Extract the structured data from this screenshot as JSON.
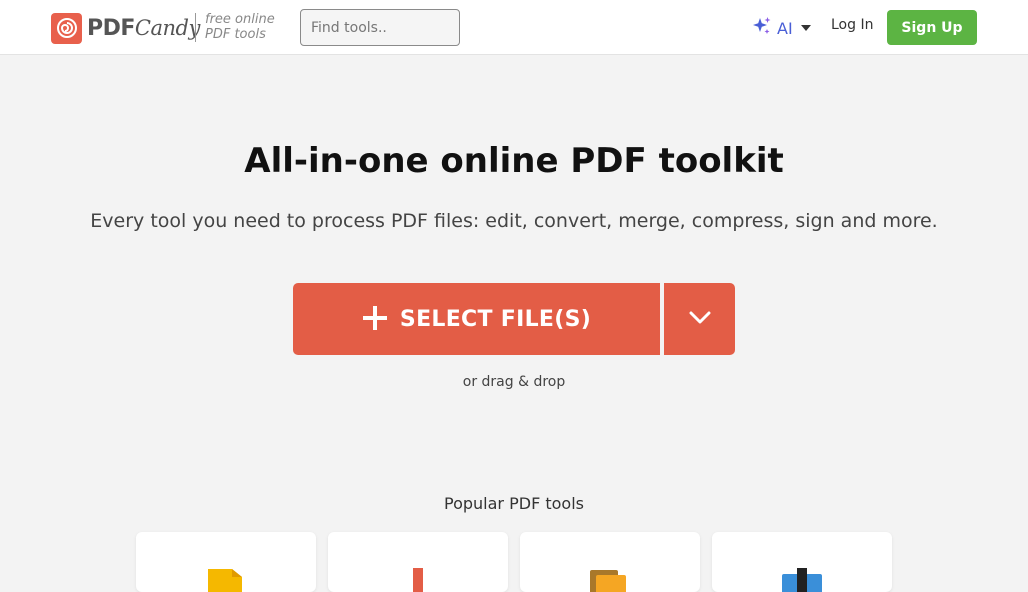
{
  "header": {
    "logo": {
      "brand_bold": "PDF",
      "brand_italic": "Candy"
    },
    "tagline": {
      "line1": "free online",
      "line2": "PDF tools"
    },
    "search": {
      "placeholder": "Find tools.."
    },
    "ai_menu": {
      "label": "AI",
      "icon": "sparkles-icon"
    },
    "login_label": "Log In",
    "signup_label": "Sign Up"
  },
  "hero": {
    "title": "All-in-one online PDF toolkit",
    "subtitle": "Every tool you need to process PDF files: edit, convert, merge, compress, sign and more.",
    "select_button_label": "SELECT FILE(S)",
    "drag_hint": "or drag & drop"
  },
  "popular": {
    "title": "Popular PDF tools",
    "cards": [
      {
        "icon": "document-icon"
      },
      {
        "icon": "compress-icon"
      },
      {
        "icon": "files-icon"
      },
      {
        "icon": "merge-icon"
      }
    ]
  },
  "colors": {
    "primary": "#e35d46",
    "signup": "#5cb443",
    "ai": "#4a5fd6",
    "background": "#f3f3f3"
  }
}
